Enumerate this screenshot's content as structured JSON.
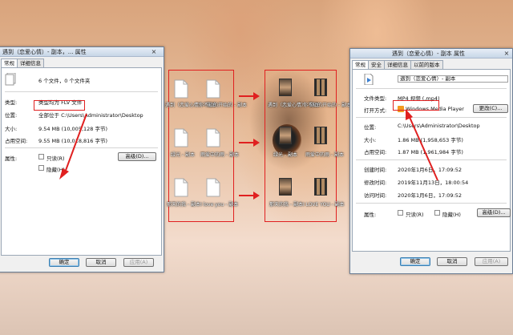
{
  "left_dialog": {
    "title": "遇到（恋爱心情）- 副本，... 属性",
    "close_icon": "×",
    "tabs": [
      "常规",
      "详细信息"
    ],
    "count_text": "6 个文件，0 个文件夹",
    "type_label": "类型:",
    "type_value": "类型均为 FLV 文件",
    "location_label": "位置:",
    "location_value": "全部位于 C:\\Users\\Administrator\\Desktop",
    "size_label": "大小:",
    "size_value": "9.54 MB (10,005,128 字节)",
    "disk_label": "占用空间:",
    "disk_value": "9.55 MB (10,018,816 字节)",
    "attr_label": "属性:",
    "readonly_label": "只读(R)",
    "hidden_label": "隐藏(H)",
    "advanced_button": "高级(D)...",
    "ok_button": "确定",
    "cancel_button": "取消",
    "apply_button": "应用(A)"
  },
  "middle_files": [
    {
      "label": "遇到（恋爱心情）- 副本"
    },
    {
      "label": "你不知的开始的 - 副本"
    },
    {
      "label": "绿光 - 副本"
    },
    {
      "label": "雨爱中的雨 - 副本"
    },
    {
      "label": "那天的我 - 副本"
    },
    {
      "label": "I love you - 副本"
    }
  ],
  "right_files": [
    {
      "label": "遇到（恋爱心情）- 副本"
    },
    {
      "label": "你不知的开始的 - 副本"
    },
    {
      "label": "绿光 - 副本"
    },
    {
      "label": "雨爱中的雨 - 副本"
    },
    {
      "label": "那天的我 - 副本"
    },
    {
      "label": "I LOVE YOU - 副本"
    }
  ],
  "right_dialog": {
    "title": "遇到（恋爱心情）- 副本 属性",
    "close_icon": "×",
    "tabs": [
      "常规",
      "安全",
      "详细信息",
      "以前的版本"
    ],
    "filename": "遇到（恋爱心情）- 副本",
    "filetype_label": "文件类型:",
    "filetype_value": "MP4 视频 (.mp4)",
    "open_with_label": "打开方式:",
    "open_with_value": "Windows Media Player",
    "change_button": "更改(C)...",
    "location_label": "位置:",
    "location_value": "C:\\Users\\Administrator\\Desktop",
    "size_label": "大小:",
    "size_value": "1.86 MB (1,958,653 字节)",
    "disk_label": "占用空间:",
    "disk_value": "1.87 MB (1,961,984 字节)",
    "created_label": "创建时间:",
    "created_value": "2020年1月6日，17:09:52",
    "modified_label": "修改时间:",
    "modified_value": "2019年11月13日，18:00:54",
    "accessed_label": "访问时间:",
    "accessed_value": "2020年1月6日，17:09:52",
    "attr_label": "属性:",
    "readonly_label": "只读(R)",
    "hidden_label": "隐藏(H)",
    "advanced_button": "高级(D)...",
    "ok_button": "确定",
    "cancel_button": "取消",
    "apply_button": "应用(A)"
  },
  "colors": {
    "annotation": "#e02020",
    "dialog_bg": "#f0f0f0"
  }
}
